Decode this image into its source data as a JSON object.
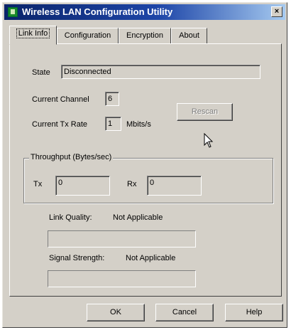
{
  "window": {
    "title": "Wireless LAN Configuration Utility",
    "close_label": "×"
  },
  "tabs": [
    {
      "label": "Link Info",
      "active": true
    },
    {
      "label": "Configuration",
      "active": false
    },
    {
      "label": "Encryption",
      "active": false
    },
    {
      "label": "About",
      "active": false
    }
  ],
  "link_info": {
    "state_label": "State",
    "state_value": "Disconnected",
    "channel_label": "Current Channel",
    "channel_value": "6",
    "tx_rate_label": "Current Tx Rate",
    "tx_rate_value": "1",
    "tx_rate_unit": "Mbits/s",
    "rescan_label": "Rescan",
    "throughput": {
      "title": "Throughput (Bytes/sec)",
      "tx_label": "Tx",
      "tx_value": "0",
      "rx_label": "Rx",
      "rx_value": "0"
    },
    "link_quality_label": "Link Quality:",
    "link_quality_value": "Not Applicable",
    "signal_strength_label": "Signal Strength:",
    "signal_strength_value": "Not Applicable"
  },
  "footer": {
    "ok_label": "OK",
    "cancel_label": "Cancel",
    "help_label": "Help"
  },
  "colors": {
    "face": "#d4d0c8",
    "title_start": "#0a246a",
    "title_end": "#a6caf0"
  }
}
